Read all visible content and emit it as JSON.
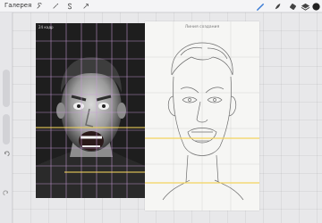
{
  "toolbar": {
    "gallery_label": "Галерея",
    "left_icons": [
      "wrench-icon",
      "magic-wand-icon",
      "selection-s-icon",
      "transform-arrow-icon"
    ],
    "right_icons": [
      "brush-icon",
      "smudge-icon",
      "eraser-icon",
      "layers-icon",
      "color-swatch-icon"
    ]
  },
  "photo": {
    "label": "24 кадр"
  },
  "sketch": {
    "title": "Линия создания"
  },
  "sidebar": {
    "undo_icon": "undo-icon"
  },
  "colors": {
    "accent": "#3a7bd5",
    "guide_line": "#f2d45c",
    "grid": "#c89bd8"
  }
}
